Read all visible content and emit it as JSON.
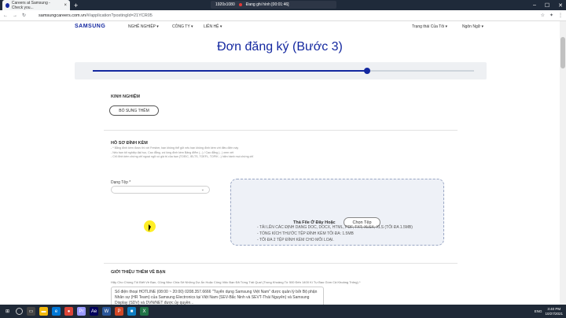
{
  "browser": {
    "tab_title": "Careers at Samsung - Check you...",
    "new_tab": "+",
    "url_host": "samsungcareers.com.vn",
    "url_path": "/#/application?postingId=21YCR05",
    "recording": {
      "resolution": "1920x1080",
      "status": "Đang ghi hình [00:01:46]"
    }
  },
  "nav": {
    "logo": "SAMSUNG",
    "items": [
      "NGHỀ NGHIỆP ▾",
      "CÔNG TY ▾",
      "LIÊN HỆ ▾"
    ],
    "status": "Trạng thái Của Tôi ▾",
    "language": "Ngôn Ngữ ▾"
  },
  "page_title": "Đơn đăng ký (Bước 3)",
  "progress": {
    "value": 0.72
  },
  "experience": {
    "label": "KINH NGHIỆM",
    "add_button": "BỔ SUNG THÊM"
  },
  "attachments": {
    "label": "HỒ SƠ ĐÍNH KÈM",
    "notes": [
      "- * Bằng đính kèm được thi với Fresher, bạn không thể gửi nếu bạn không đính kèm với điều điện này",
      "- Nếu bạn tốt nghiệp đại học, Cao đẳng, vui lòng đính kèm Bảng điểm (...) / Cao đẳng (...) xem xét",
      "- Chỉ đính kèm chứng chỉ ngoại ngữ có giá trị của bạn (TOEIC, IELTS, TOEFL, TOPIK...) hiện hành mọi chứng chỉ"
    ],
    "file_type_label": "Dạng Tệp *",
    "file_type_value": "",
    "drop_text": "Thả File Ở Đây Hoặc",
    "choose_button": "Chọn Tệp",
    "rules": [
      "- TẢI LÊN CÁC ĐỊNH DẠNG DOC, DOCX, HTML, PDF, TXT, XLSX, XLS (TỐI ĐA 1.5MB)",
      "- TỔNG KÍCH THƯỚC TỆP ĐÍNH KÈM TỐI ĐA: 1.5MB",
      "- TỐI ĐA 2 TỆP ĐÍNH KÈM CHO MỖI LOẠI."
    ]
  },
  "intro": {
    "label": "GIỚI THIỆU THÊM VỀ BẠN",
    "hint": "Hãy Cho Chúng Tôi Biết Về Bạn, Cũng Như Chia Sẻ Những Dự Án Hoặc Công Việc Bạn Đã Từng Trải Qua! (Trong Khoảng Từ 500 Đến 1400 Kí Tự Bao Gồm Cả Khoảng Trống) *",
    "text": "Số điện thoại HOTLINE (08:00 ~ 20:00) 0208.357.6666 \"Tuyển dụng Samsung Việt Nam\" được quản lý bởi Bộ phận Nhân sự (HR Team) của Samsung Electronics tại Việt Nam (SEV-Bắc Ninh và SEVT-Thái Nguyên) và Samsung Display (SDV) và DVN/NET được ủy quyền..."
  },
  "taskbar": {
    "time": "3:40 PM",
    "date": "10/27/2021",
    "lang": "ENG"
  },
  "colors": {
    "brand": "#1428a0",
    "bg": "#ffffff"
  }
}
